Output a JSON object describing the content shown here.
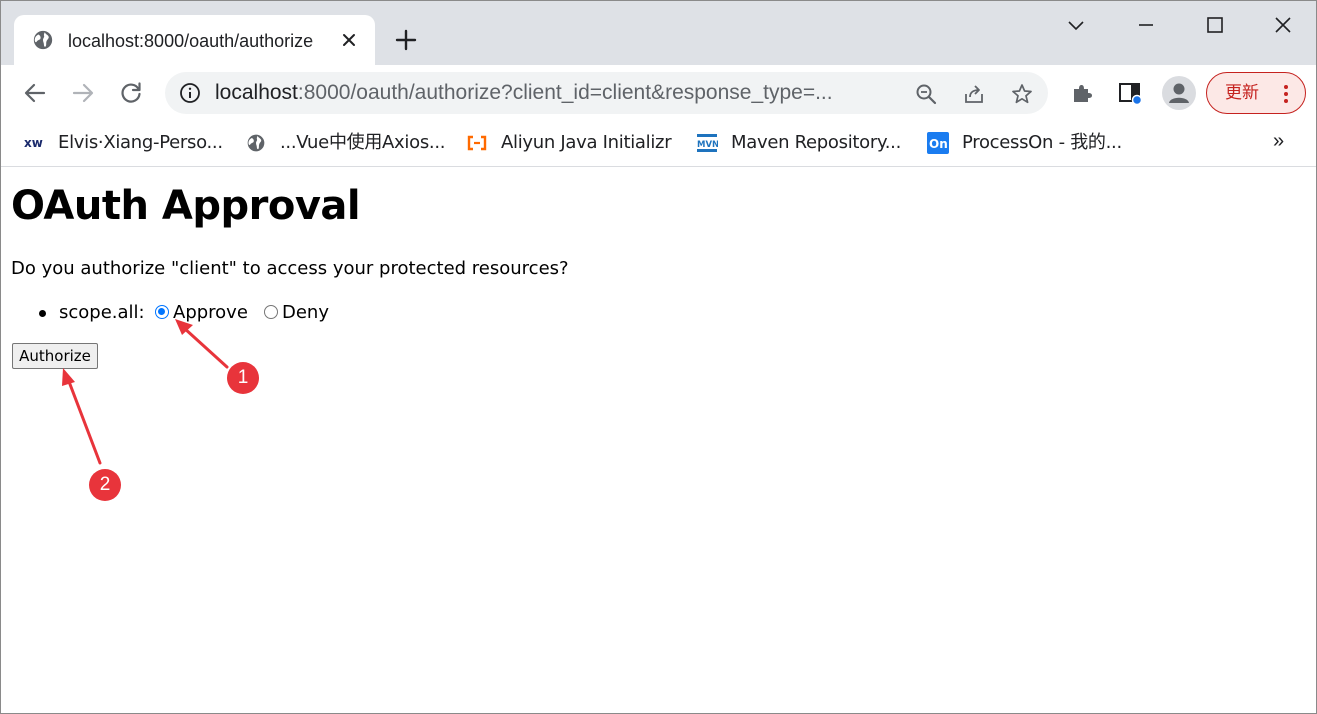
{
  "browser": {
    "tab": {
      "title": "localhost:8000/oauth/authorize",
      "favicon": "globe-icon"
    },
    "window_controls": [
      "chevron-down-icon",
      "minimize-icon",
      "maximize-icon",
      "close-icon"
    ],
    "address_bar": {
      "host": "localhost",
      "rest": ":8000/oauth/authorize?client_id=client&response_type=..."
    },
    "update_button": {
      "label": "更新"
    },
    "bookmarks": [
      {
        "label": "Elvis·Xiang-Perso...",
        "icon": "xw-logo-icon"
      },
      {
        "label": "...Vue中使用Axios...",
        "icon": "globe-icon"
      },
      {
        "label": "Aliyun Java Initializr",
        "icon": "aliyun-logo-icon"
      },
      {
        "label": "Maven Repository...",
        "icon": "maven-logo-icon"
      },
      {
        "label": "ProcessOn - 我的...",
        "icon": "processon-logo-icon"
      }
    ],
    "bookmarks_more": "»"
  },
  "page": {
    "title": "OAuth Approval",
    "question": "Do you authorize \"client\" to access your protected resources?",
    "scopes": [
      {
        "label": "scope.all:",
        "selected": "Approve",
        "options": [
          "Approve",
          "Deny"
        ]
      }
    ],
    "authorize_button": "Authorize"
  },
  "annotations": [
    {
      "number": "1",
      "target": "approve-radio"
    },
    {
      "number": "2",
      "target": "authorize-button"
    }
  ],
  "colors": {
    "accent": "#0075ff",
    "annotation": "#e8343b",
    "update": "#c5221f"
  }
}
